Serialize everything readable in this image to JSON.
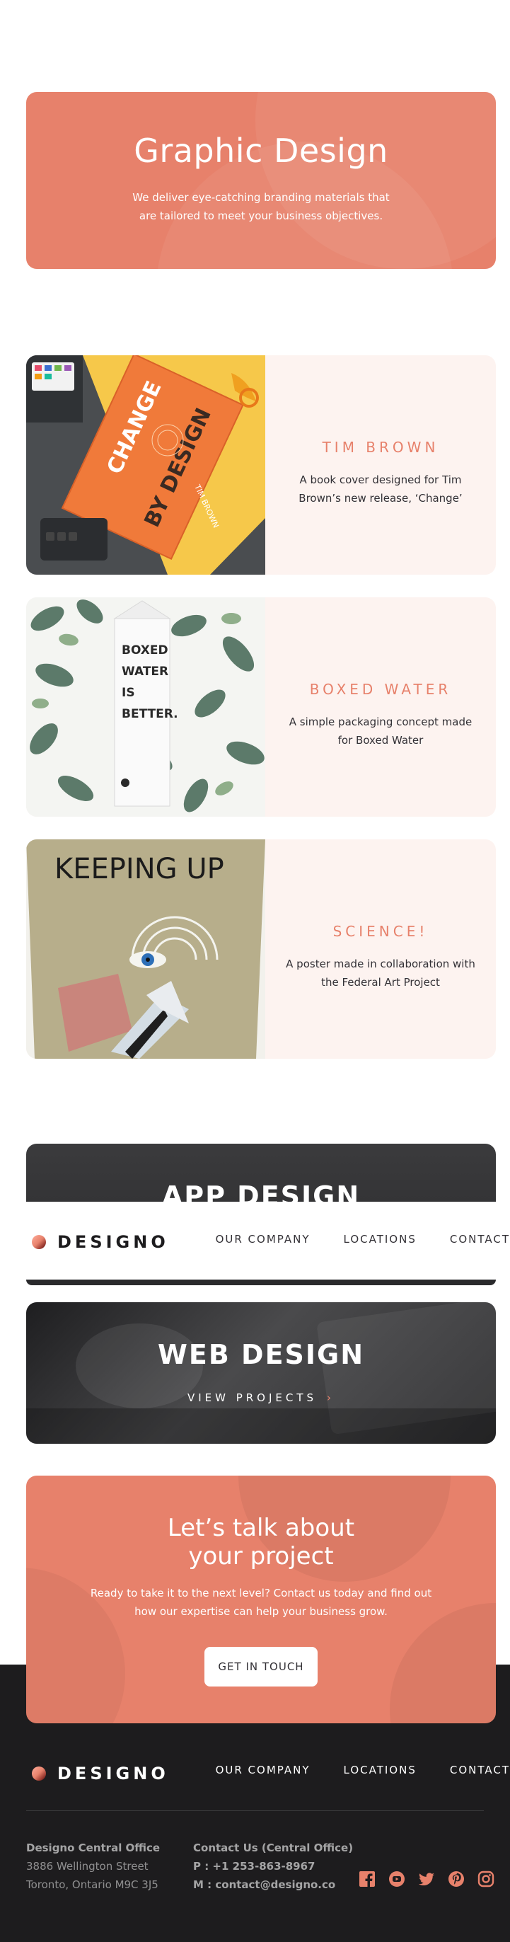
{
  "hero": {
    "title": "Graphic Design",
    "text": "We deliver eye-catching branding materials that are tailored to meet your business objectives."
  },
  "projects": [
    {
      "title": "TIM BROWN",
      "desc": "A book cover designed for Tim Brown’s new release, ‘Change’",
      "image_text": [
        "CHANGE",
        "BY DESIGN",
        "TIM BROWN"
      ]
    },
    {
      "title": "BOXED WATER",
      "desc": "A simple packaging concept made for Boxed Water",
      "image_text": [
        "BOXED",
        "WATER",
        "IS",
        "BETTER."
      ]
    },
    {
      "title": "SCIENCE!",
      "desc": "A poster made in collaboration with the Federal Art Project",
      "image_text": [
        "KEEPING UP"
      ]
    }
  ],
  "app_card": {
    "title": "APP DESIGN"
  },
  "nav": {
    "logo": "DESIGNO",
    "links": [
      "OUR COMPANY",
      "LOCATIONS",
      "CONTACT"
    ]
  },
  "web_card": {
    "title": "WEB DESIGN",
    "cta": "VIEW PROJECTS",
    "chevron": "›"
  },
  "cta": {
    "title_line1": "Let’s talk about",
    "title_line2": "your project",
    "text": "Ready to take it to the next level? Contact us today and find out how our expertise can help your business grow.",
    "button": "GET IN TOUCH"
  },
  "footer": {
    "logo": "DESIGNO",
    "links": [
      "OUR COMPANY",
      "LOCATIONS",
      "CONTACT"
    ],
    "office": {
      "title": "Designo Central Office",
      "line1": "3886 Wellington Street",
      "line2": "Toronto, Ontario M9C 3J5"
    },
    "contact": {
      "title": "Contact Us (Central Office)",
      "phone": "P : +1 253-863-8967",
      "email": "M : contact@designo.co"
    },
    "socials": [
      "facebook-icon",
      "youtube-icon",
      "twitter-icon",
      "pinterest-icon",
      "instagram-icon"
    ]
  },
  "colors": {
    "peach": "#e7816b",
    "light_peach": "#fdf3f0",
    "dark": "#1d1c1e",
    "text": "#333136"
  }
}
